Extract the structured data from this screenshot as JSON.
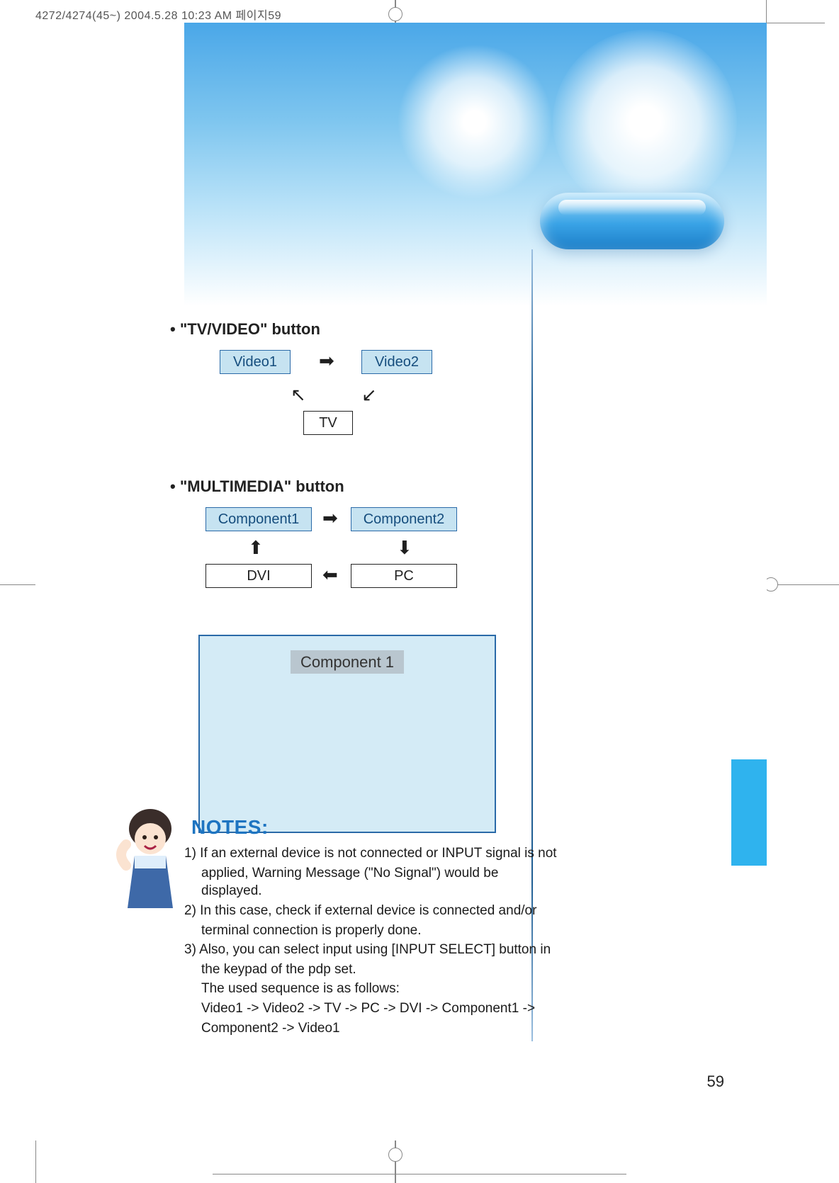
{
  "meta_header": "4272/4274(45~)  2004.5.28 10:23 AM  페이지59",
  "section1": {
    "title": "\"TV/VIDEO\" button",
    "box_video1": "Video1",
    "box_video2": "Video2",
    "box_tv": "TV"
  },
  "section2": {
    "title": "\"MULTIMEDIA\" button",
    "box_comp1": "Component1",
    "box_comp2": "Component2",
    "box_dvi": "DVI",
    "box_pc": "PC"
  },
  "preview": {
    "label": "Component 1"
  },
  "notes": {
    "title": "NOTES:",
    "n1a": "1)  If an external device is not connected or INPUT signal is not",
    "n1b": "applied, Warning Message (\"No Signal\") would be displayed.",
    "n2a": "2)  In this case, check if external device is connected and/or",
    "n2b": "terminal connection is properly done.",
    "n3a": "3) Also, you can select input using [INPUT SELECT] button in",
    "n3b": "the keypad of the pdp set.",
    "n3c": "The used sequence is as follows:",
    "n3d": "Video1 -> Video2 -> TV -> PC -> DVI -> Component1 ->",
    "n3e": "Component2 -> Video1"
  },
  "page_number": "59"
}
